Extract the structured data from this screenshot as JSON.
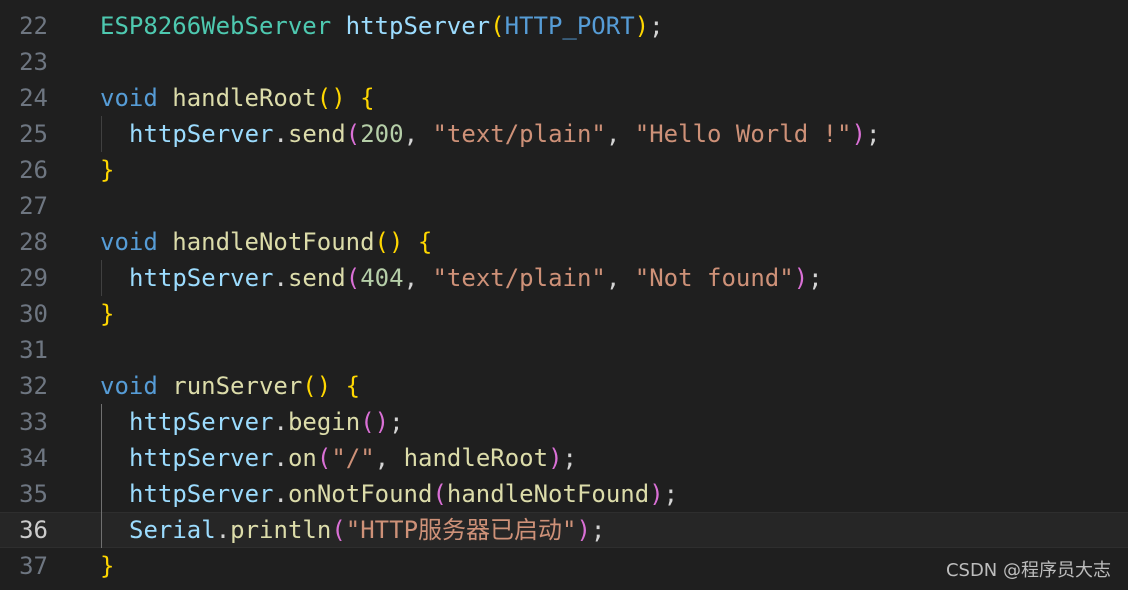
{
  "editor": {
    "first_line_number": 22,
    "active_line_number": 36,
    "theme_colors": {
      "background": "#1f1f1f",
      "type": "#4ec9b0",
      "variable": "#9cdcfe",
      "function": "#dcdcaa",
      "keyword": "#569cd6",
      "string": "#ce9178",
      "number": "#b5cea8",
      "bracket_level_1": "#ffd700",
      "bracket_level_2": "#da70d6"
    },
    "lines": [
      {
        "number": "22",
        "indent": 0,
        "tokens": [
          {
            "t": "ESP8266WebServer",
            "c": "type"
          },
          {
            "t": " ",
            "c": "punc"
          },
          {
            "t": "httpServer",
            "c": "var"
          },
          {
            "t": "(",
            "c": "p1"
          },
          {
            "t": "HTTP_PORT",
            "c": "kw"
          },
          {
            "t": ")",
            "c": "p1"
          },
          {
            "t": ";",
            "c": "punc"
          }
        ]
      },
      {
        "number": "23",
        "indent": 0,
        "tokens": []
      },
      {
        "number": "24",
        "indent": 0,
        "tokens": [
          {
            "t": "void",
            "c": "kw"
          },
          {
            "t": " ",
            "c": "punc"
          },
          {
            "t": "handleRoot",
            "c": "func"
          },
          {
            "t": "()",
            "c": "p1"
          },
          {
            "t": " ",
            "c": "punc"
          },
          {
            "t": "{",
            "c": "p1"
          }
        ]
      },
      {
        "number": "25",
        "indent": 1,
        "tokens": [
          {
            "t": "httpServer",
            "c": "var"
          },
          {
            "t": ".",
            "c": "punc"
          },
          {
            "t": "send",
            "c": "func"
          },
          {
            "t": "(",
            "c": "p2"
          },
          {
            "t": "200",
            "c": "num"
          },
          {
            "t": ", ",
            "c": "punc"
          },
          {
            "t": "\"text/plain\"",
            "c": "str"
          },
          {
            "t": ", ",
            "c": "punc"
          },
          {
            "t": "\"Hello World !\"",
            "c": "str"
          },
          {
            "t": ")",
            "c": "p2"
          },
          {
            "t": ";",
            "c": "punc"
          }
        ]
      },
      {
        "number": "26",
        "indent": 0,
        "tokens": [
          {
            "t": "}",
            "c": "p1"
          }
        ]
      },
      {
        "number": "27",
        "indent": 0,
        "tokens": []
      },
      {
        "number": "28",
        "indent": 0,
        "tokens": [
          {
            "t": "void",
            "c": "kw"
          },
          {
            "t": " ",
            "c": "punc"
          },
          {
            "t": "handleNotFound",
            "c": "func"
          },
          {
            "t": "()",
            "c": "p1"
          },
          {
            "t": " ",
            "c": "punc"
          },
          {
            "t": "{",
            "c": "p1"
          }
        ]
      },
      {
        "number": "29",
        "indent": 1,
        "tokens": [
          {
            "t": "httpServer",
            "c": "var"
          },
          {
            "t": ".",
            "c": "punc"
          },
          {
            "t": "send",
            "c": "func"
          },
          {
            "t": "(",
            "c": "p2"
          },
          {
            "t": "404",
            "c": "num"
          },
          {
            "t": ", ",
            "c": "punc"
          },
          {
            "t": "\"text/plain\"",
            "c": "str"
          },
          {
            "t": ", ",
            "c": "punc"
          },
          {
            "t": "\"Not found\"",
            "c": "str"
          },
          {
            "t": ")",
            "c": "p2"
          },
          {
            "t": ";",
            "c": "punc"
          }
        ]
      },
      {
        "number": "30",
        "indent": 0,
        "tokens": [
          {
            "t": "}",
            "c": "p1"
          }
        ]
      },
      {
        "number": "31",
        "indent": 0,
        "tokens": []
      },
      {
        "number": "32",
        "indent": 0,
        "tokens": [
          {
            "t": "void",
            "c": "kw"
          },
          {
            "t": " ",
            "c": "punc"
          },
          {
            "t": "runServer",
            "c": "func"
          },
          {
            "t": "()",
            "c": "p1"
          },
          {
            "t": " ",
            "c": "punc"
          },
          {
            "t": "{",
            "c": "p1"
          }
        ]
      },
      {
        "number": "33",
        "indent": 1,
        "tokens": [
          {
            "t": "httpServer",
            "c": "var"
          },
          {
            "t": ".",
            "c": "punc"
          },
          {
            "t": "begin",
            "c": "func"
          },
          {
            "t": "()",
            "c": "p2"
          },
          {
            "t": ";",
            "c": "punc"
          }
        ]
      },
      {
        "number": "34",
        "indent": 1,
        "tokens": [
          {
            "t": "httpServer",
            "c": "var"
          },
          {
            "t": ".",
            "c": "punc"
          },
          {
            "t": "on",
            "c": "func"
          },
          {
            "t": "(",
            "c": "p2"
          },
          {
            "t": "\"/\"",
            "c": "str"
          },
          {
            "t": ", ",
            "c": "punc"
          },
          {
            "t": "handleRoot",
            "c": "func"
          },
          {
            "t": ")",
            "c": "p2"
          },
          {
            "t": ";",
            "c": "punc"
          }
        ]
      },
      {
        "number": "35",
        "indent": 1,
        "tokens": [
          {
            "t": "httpServer",
            "c": "var"
          },
          {
            "t": ".",
            "c": "punc"
          },
          {
            "t": "onNotFound",
            "c": "func"
          },
          {
            "t": "(",
            "c": "p2"
          },
          {
            "t": "handleNotFound",
            "c": "func"
          },
          {
            "t": ")",
            "c": "p2"
          },
          {
            "t": ";",
            "c": "punc"
          }
        ]
      },
      {
        "number": "36",
        "indent": 1,
        "tokens": [
          {
            "t": "Serial",
            "c": "var"
          },
          {
            "t": ".",
            "c": "punc"
          },
          {
            "t": "println",
            "c": "func"
          },
          {
            "t": "(",
            "c": "p2"
          },
          {
            "t": "\"HTTP服务器已启动\"",
            "c": "str"
          },
          {
            "t": ")",
            "c": "p2"
          },
          {
            "t": ";",
            "c": "punc"
          }
        ]
      },
      {
        "number": "37",
        "indent": 0,
        "tokens": [
          {
            "t": "}",
            "c": "p1"
          }
        ]
      }
    ]
  },
  "watermark": "CSDN @程序员大志"
}
